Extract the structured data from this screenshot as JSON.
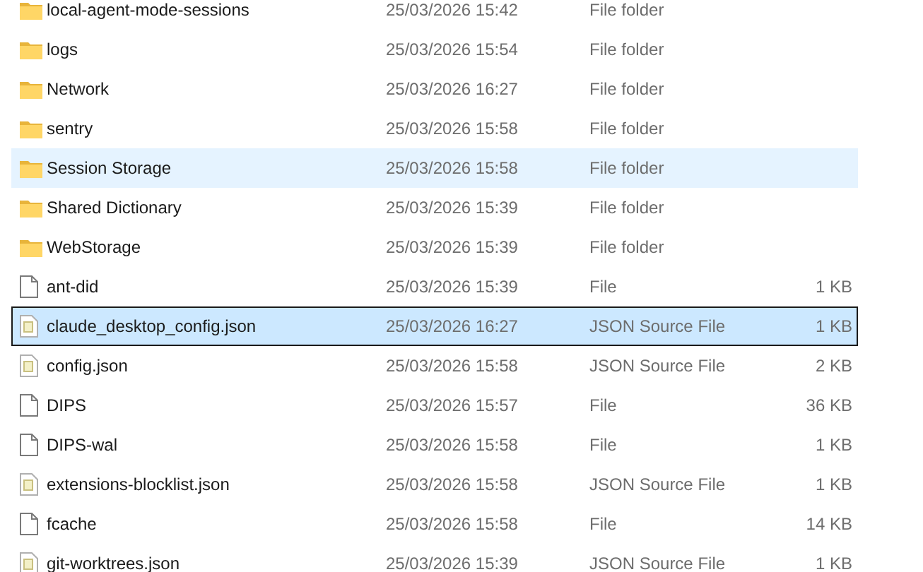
{
  "files": [
    {
      "kind": "folder",
      "name": "local-agent-mode-sessions",
      "date": "25/03/2026 15:42",
      "type": "File folder",
      "selected": false,
      "hovered": false
    },
    {
      "kind": "folder",
      "name": "logs",
      "date": "25/03/2026 15:54",
      "type": "File folder",
      "selected": false,
      "hovered": false
    },
    {
      "kind": "folder",
      "name": "Network",
      "date": "25/03/2026 16:27",
      "type": "File folder",
      "selected": false,
      "hovered": false
    },
    {
      "kind": "folder",
      "name": "sentry",
      "date": "25/03/2026 15:58",
      "type": "File folder",
      "selected": false,
      "hovered": false
    },
    {
      "kind": "folder",
      "name": "Session Storage",
      "date": "25/03/2026 15:58",
      "type": "File folder",
      "selected": false,
      "hovered": true
    },
    {
      "kind": "folder",
      "name": "Shared Dictionary",
      "date": "25/03/2026 15:39",
      "type": "File folder",
      "selected": false,
      "hovered": false
    },
    {
      "kind": "folder",
      "name": "WebStorage",
      "date": "25/03/2026 15:39",
      "type": "File folder",
      "selected": false,
      "hovered": false
    },
    {
      "kind": "file",
      "name": "ant-did",
      "date": "25/03/2026 15:39",
      "type": "File",
      "size": "1 KB",
      "selected": false,
      "hovered": false
    },
    {
      "kind": "json",
      "name": "claude_desktop_config.json",
      "date": "25/03/2026 16:27",
      "type": "JSON Source File",
      "size": "1 KB",
      "selected": true,
      "hovered": false
    },
    {
      "kind": "json",
      "name": "config.json",
      "date": "25/03/2026 15:58",
      "type": "JSON Source File",
      "size": "2 KB",
      "selected": false,
      "hovered": false
    },
    {
      "kind": "file",
      "name": "DIPS",
      "date": "25/03/2026 15:57",
      "type": "File",
      "size": "36 KB",
      "selected": false,
      "hovered": false
    },
    {
      "kind": "file",
      "name": "DIPS-wal",
      "date": "25/03/2026 15:58",
      "type": "File",
      "size": "1 KB",
      "selected": false,
      "hovered": false
    },
    {
      "kind": "json",
      "name": "extensions-blocklist.json",
      "date": "25/03/2026 15:58",
      "type": "JSON Source File",
      "size": "1 KB",
      "selected": false,
      "hovered": false
    },
    {
      "kind": "file",
      "name": "fcache",
      "date": "25/03/2026 15:58",
      "type": "File",
      "size": "14 KB",
      "selected": false,
      "hovered": false
    },
    {
      "kind": "json",
      "name": "git-worktrees.json",
      "date": "25/03/2026 15:39",
      "type": "JSON Source File",
      "size": "1 KB",
      "selected": false,
      "hovered": false
    }
  ]
}
